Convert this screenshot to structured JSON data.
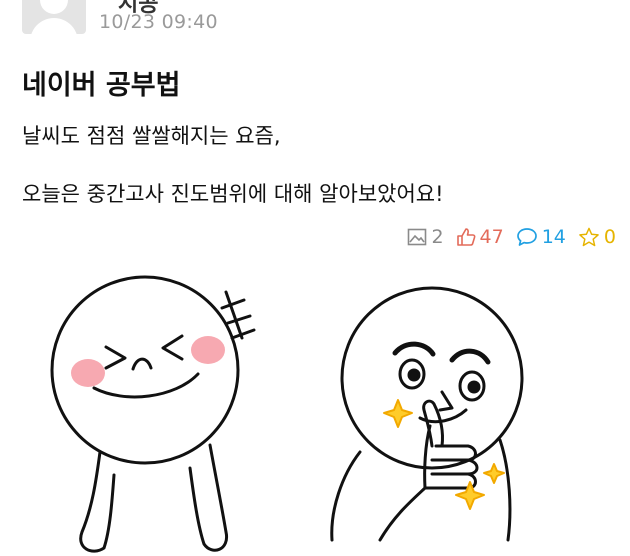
{
  "post": {
    "author_fragment": "시공",
    "timestamp": "10/23 09:40",
    "title": "네이버 공부법",
    "paragraphs": [
      "날씨도 점점 쌀쌀해지는 요즘,",
      "오늘은 중간고사 진도범위에 대해 알아보았어요!"
    ]
  },
  "stats": {
    "images": "2",
    "likes": "47",
    "comments": "14",
    "scraps": "0"
  },
  "icons": {
    "images": "image-icon",
    "likes": "thumbs-up-icon",
    "comments": "comment-icon",
    "scraps": "star-icon"
  },
  "colors": {
    "likes": "#e36b5a",
    "comments": "#21a0e2",
    "scraps": "#e6b400",
    "images": "#8a8a8a",
    "timestamp": "#9a9a9a"
  }
}
